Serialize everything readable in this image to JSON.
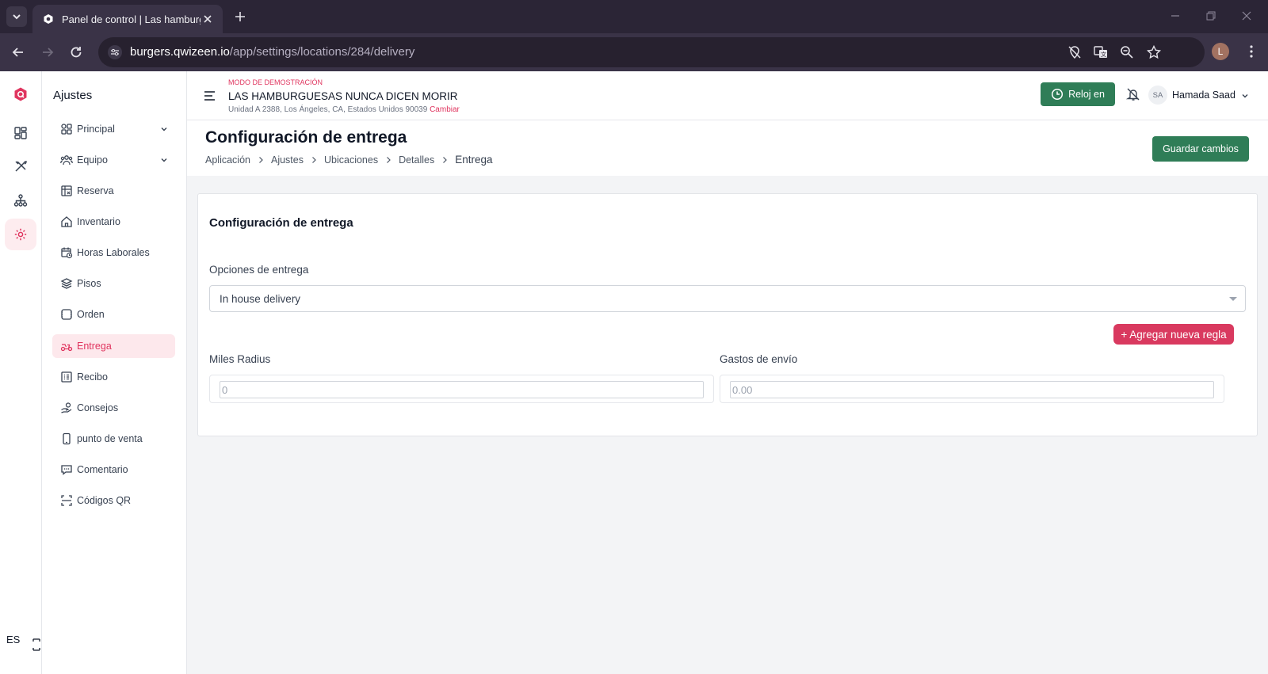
{
  "browser": {
    "tab_title": "Panel de control | Las hamburgu",
    "url_host": "burgers.qwizeen.io",
    "url_path": "/app/settings/locations/284/delivery",
    "profile_initial": "L"
  },
  "sidebar": {
    "title": "Ajustes",
    "items": [
      {
        "label": "Principal",
        "icon": "shapes-icon"
      },
      {
        "label": "Equipo",
        "icon": "team-icon"
      },
      {
        "label": "Reserva",
        "icon": "table-grid-icon"
      },
      {
        "label": "Inventario",
        "icon": "home-icon"
      },
      {
        "label": "Horas Laborales",
        "icon": "calendar-clock-icon"
      },
      {
        "label": "Pisos",
        "icon": "layers-icon"
      },
      {
        "label": "Orden",
        "icon": "order-icon"
      },
      {
        "label": "Entrega",
        "icon": "scooter-icon"
      },
      {
        "label": "Recibo",
        "icon": "receipt-icon"
      },
      {
        "label": "Consejos",
        "icon": "tip-hand-icon"
      },
      {
        "label": "punto de venta",
        "icon": "tablet-icon"
      },
      {
        "label": "Comentario",
        "icon": "comment-icon"
      },
      {
        "label": "Códigos QR",
        "icon": "qr-scan-icon"
      }
    ]
  },
  "lang": "ES",
  "header": {
    "demo": "MODO DE DEMOSTRACIÓN",
    "restaurant": "LAS HAMBURGUESAS NUNCA DICEN MORIR",
    "address": "Unidad A 2388, Los Ángeles, CA, Estados Unidos 90039",
    "change": "Cambiar",
    "clock_in": "Reloj en",
    "avatar": "SA",
    "user": "Hamada Saad"
  },
  "page": {
    "title": "Configuración de entrega",
    "breadcrumbs": [
      "Aplicación",
      "Ajustes",
      "Ubicaciones",
      "Detalles",
      "Entrega"
    ],
    "save": "Guardar cambios"
  },
  "card": {
    "title": "Configuración de entrega",
    "options_label": "Opciones de entrega",
    "options_value": "In house delivery",
    "add_rule": "+ Agregar nueva regla",
    "radius_label": "Miles Radius",
    "radius_value": "0",
    "fee_label": "Gastos de envío",
    "fee_value": "0.00"
  },
  "colors": {
    "accent": "#e0355f",
    "green": "#2f7d57"
  }
}
